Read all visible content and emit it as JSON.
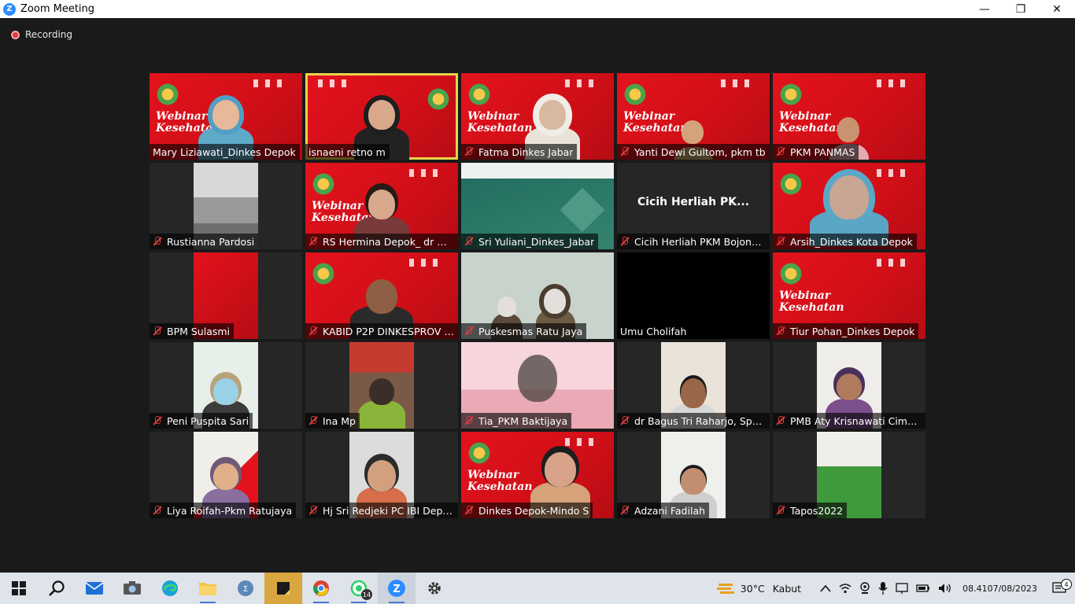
{
  "window": {
    "title": "Zoom Meeting",
    "logo": "Z",
    "minimize": "—",
    "restore": "❐",
    "close": "✕"
  },
  "meeting": {
    "recording_label": "Recording"
  },
  "participants": [
    "Mary Liziawati_Dinkes Depok",
    "isnaeni retno m",
    "Fatma Dinkes Jabar",
    "Yanti Dewi Gultom, pkm tb",
    "PKM PANMAS",
    "Rustianna Pardosi",
    "RS Hermina Depok_ dr Her...",
    "Sri Yuliani_Dinkes_Jabar",
    "Cicih Herliah PKM Bojongs...",
    "Arsih_Dinkes Kota Depok",
    "BPM Sulasmi",
    "KABID P2P DINKESPROV JA...",
    "Puskesmas Ratu Jaya",
    "Umu Cholifah",
    "Tiur Pohan_Dinkes Depok",
    "Peni Puspita Sari",
    "Ina Mp",
    "Tia_PKM Baktijaya",
    "dr Bagus Tri Raharjo, SpO...",
    "PMB Aty Krisnawati Ciman...",
    "Liya Roifah-Pkm Ratujaya",
    "Hj Sri Redjeki PC IBI Depok",
    "Dinkes Depok-Mindo S",
    "Adzani Fadilah",
    "Tapos2022"
  ],
  "center_name": "Cicih  Herliah  PK...",
  "banner": {
    "text_line1": "Webinar",
    "text_line2": "Kesehatan"
  },
  "taskbar": {
    "weather_temp": "30°C",
    "weather_desc": "Kabut",
    "time": "08.41",
    "date": "07/08/2023",
    "whatsapp_badge": "14",
    "notification_count": "4"
  }
}
